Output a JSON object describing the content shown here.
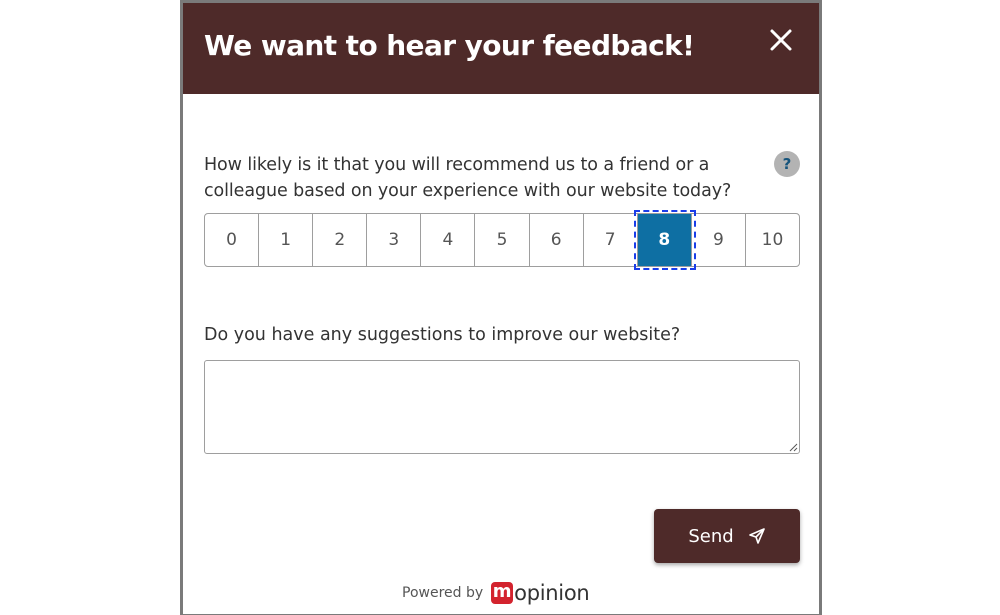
{
  "dialog": {
    "title": "We want to hear your feedback!",
    "close_icon": "close-icon"
  },
  "nps": {
    "question": "How likely is it that you will recommend us to a friend or a colleague based on your experience with our website today?",
    "help_label": "?",
    "options": [
      "0",
      "1",
      "2",
      "3",
      "4",
      "5",
      "6",
      "7",
      "8",
      "9",
      "10"
    ],
    "selected": "8"
  },
  "suggestions": {
    "label": "Do you have any suggestions to improve our website?",
    "value": "",
    "placeholder": ""
  },
  "send": {
    "label": "Send",
    "icon": "send-icon"
  },
  "footer": {
    "powered_by": "Powered by",
    "brand_m": "m",
    "brand_rest": "opinion"
  },
  "colors": {
    "header_bg": "#4e2a29",
    "selected_option": "#0e6fa3",
    "brand_red": "#d3232e"
  }
}
